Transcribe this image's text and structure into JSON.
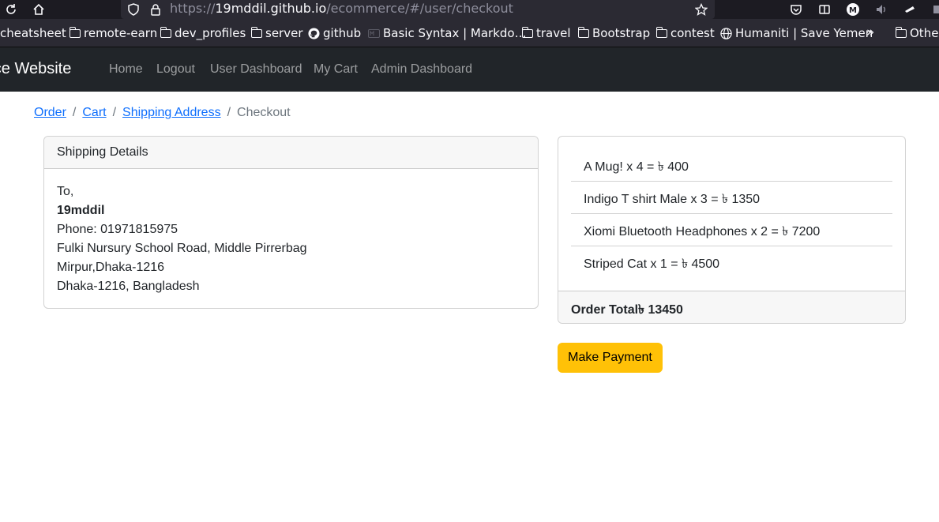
{
  "browser": {
    "url_scheme": "https://",
    "url_host": "19mddil.github.io",
    "url_path": "/ecommerce/#/user/checkout",
    "bookmarks": [
      {
        "label": "cheatsheet",
        "icon": "folder-icon"
      },
      {
        "label": "remote-earn",
        "icon": "folder-icon"
      },
      {
        "label": "dev_profiles",
        "icon": "folder-icon"
      },
      {
        "label": "server",
        "icon": "folder-icon"
      },
      {
        "label": "github",
        "icon": "github-icon"
      },
      {
        "label": "Basic Syntax | Markdo…",
        "icon": "markdown-icon"
      },
      {
        "label": "travel",
        "icon": "folder-icon"
      },
      {
        "label": "Bootstrap",
        "icon": "folder-icon"
      },
      {
        "label": "contest",
        "icon": "folder-icon"
      },
      {
        "label": "Humaniti | Save Yemen",
        "icon": "globe-icon"
      },
      {
        "label": "Othe",
        "icon": "folder-icon"
      }
    ]
  },
  "navbar": {
    "brand": "erce Website",
    "links": [
      "Home",
      "Logout",
      "User Dashboard",
      "My Cart",
      "Admin Dashboard"
    ]
  },
  "breadcrumb": {
    "items": [
      "Order",
      "Cart",
      "Shipping Address"
    ],
    "active": "Checkout"
  },
  "shipping": {
    "header": "Shipping Details",
    "to": "To,",
    "name": "19mddil",
    "phone": "Phone: 01971815975",
    "address1": "Fulki Nursury School Road, Middle Pirrerbag",
    "address2": "Mirpur,Dhaka-1216",
    "address3": "Dhaka-1216, Bangladesh"
  },
  "order": {
    "items": [
      "A Mug! x 4 = ৳ 400",
      "Indigo T shirt Male x 3 = ৳ 1350",
      "Xiomi Bluetooth Headphones x 2 = ৳ 7200",
      "Striped Cat x 1 = ৳ 4500"
    ],
    "total": "Order Total৳ 13450"
  },
  "pay_button": "Make Payment"
}
